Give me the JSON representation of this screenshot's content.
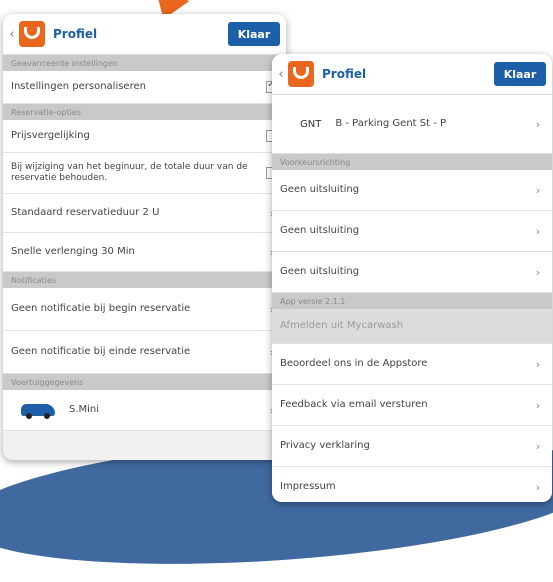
{
  "left_screen": {
    "back": "‹",
    "title": "Profiel",
    "done": "Klaar",
    "section1": "Geavanceerde instellingen",
    "personalize": "Instellingen personaliseren",
    "section2": "Reservatie-opties",
    "price_compare": "Prijsvergelijking",
    "keep_duration": "Bij wijziging van het beginuur, de totale duur van de reservatie behouden.",
    "default_duration": "Standaard reservatieduur 2 U",
    "quick_extend": "Snelle verlenging 30 Min",
    "section3": "Notificaties",
    "notif_start": "Geen notificatie bij begin reservatie",
    "notif_end": "Geen notificatie bij einde reservatie",
    "section4": "Voertuiggegevens",
    "vehicle": "S.Mini"
  },
  "right_screen": {
    "back": "‹",
    "title": "Profiel",
    "done": "Klaar",
    "gnt_code": "GNT",
    "parking": "B - Parking Gent St - P",
    "section1": "Voorkeursrichting",
    "excl1": "Geen uitsluiting",
    "excl2": "Geen uitsluiting",
    "excl3": "Geen uitsluiting",
    "section2": "App versie 2.1.1",
    "logout": "Afmelden uit Mycarwash",
    "rate": "Beoordeel ons in de Appstore",
    "feedback": "Feedback via email versturen",
    "privacy": "Privacy verklaring",
    "impressum": "Impressum"
  },
  "colors": {
    "brand_orange": "#e9661c",
    "brand_blue": "#1d5fa8",
    "section_gray": "#c9c9c9"
  },
  "icons": {
    "chevron": "›"
  }
}
